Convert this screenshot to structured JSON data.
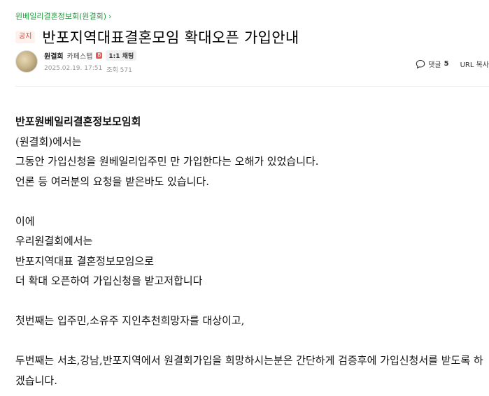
{
  "breadcrumb": {
    "label": "원베일리결혼정보회(원결회)",
    "chevron": "›"
  },
  "post": {
    "badge": "공지",
    "title": "반포지역대표결혼모임 확대오픈 가입안내"
  },
  "author": {
    "name": "원결회",
    "grade": "카페스탭",
    "grade_icon_text": "B",
    "chat_label": "1:1 채팅",
    "date": "2025.02.19. 17:51",
    "views_label": "조회 571"
  },
  "actions": {
    "comment_label": "댓글",
    "comment_count": "5",
    "url_label": "URL 복사"
  },
  "body": {
    "p1": "반포원베일리결혼정보모임회",
    "p2": "(원결회)에서는",
    "p3": "그동안 가입신청을 원베일리입주민 만 가입한다는 오해가  있었습니다.",
    "p4": "언론 등 여러분의 요청을 받은바도 있습니다.",
    "p5": "이에",
    "p6": "우리원결회에서는",
    "p7": "반포지역대표 결혼정보모임으로",
    "p8": "더 확대 오픈하여 가입신청을 받고저합니다",
    "p9": "첫번째는 입주민,소유주 지인추천희망자를 대상이고,",
    "p10": "두번째는 서초,강남,반포지역에서 원결회가입을 희망하시는분은 간단하게 검증후에 가입신청서를 받도록 하겠습니다."
  }
}
